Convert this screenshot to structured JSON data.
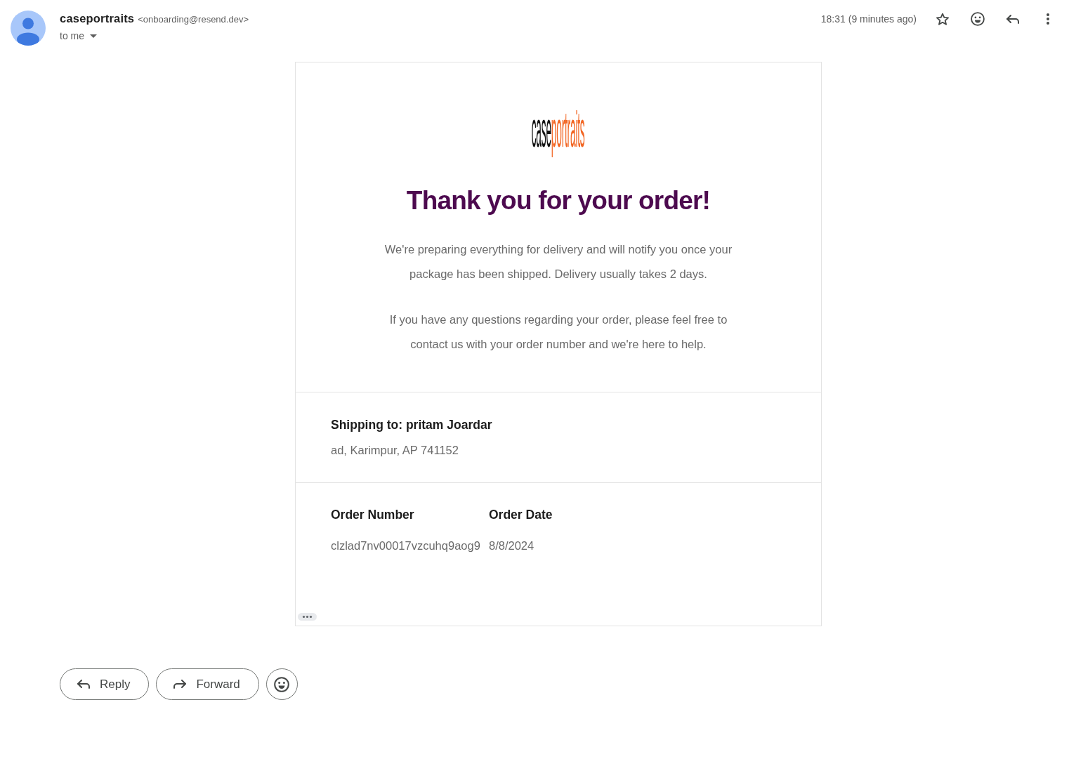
{
  "sender": {
    "name": "caseportraits",
    "email": "<onboarding@resend.dev>",
    "recipient": "to me"
  },
  "timestamp": "18:31 (9 minutes ago)",
  "message": {
    "logo": {
      "first": "case",
      "second": "portraits"
    },
    "heading": "Thank you for your order!",
    "paragraphs": [
      "We're preparing everything for delivery and will notify you once your package has been shipped. Delivery usually takes 2 days.",
      "If you have any questions regarding your order, please feel free to contact us with your order number and we're here to help."
    ],
    "shipping": {
      "heading": "Shipping to: pritam Joardar",
      "address": "ad, Karimpur, AP 741152"
    },
    "order": {
      "columns": [
        "Order Number",
        "Order Date"
      ],
      "values": [
        "clzlad7nv00017vzcuhq9aog9",
        "8/8/2024"
      ]
    }
  },
  "actions": [
    {
      "kind": "reply",
      "label": "Reply"
    },
    {
      "kind": "forward",
      "label": "Forward"
    }
  ]
}
